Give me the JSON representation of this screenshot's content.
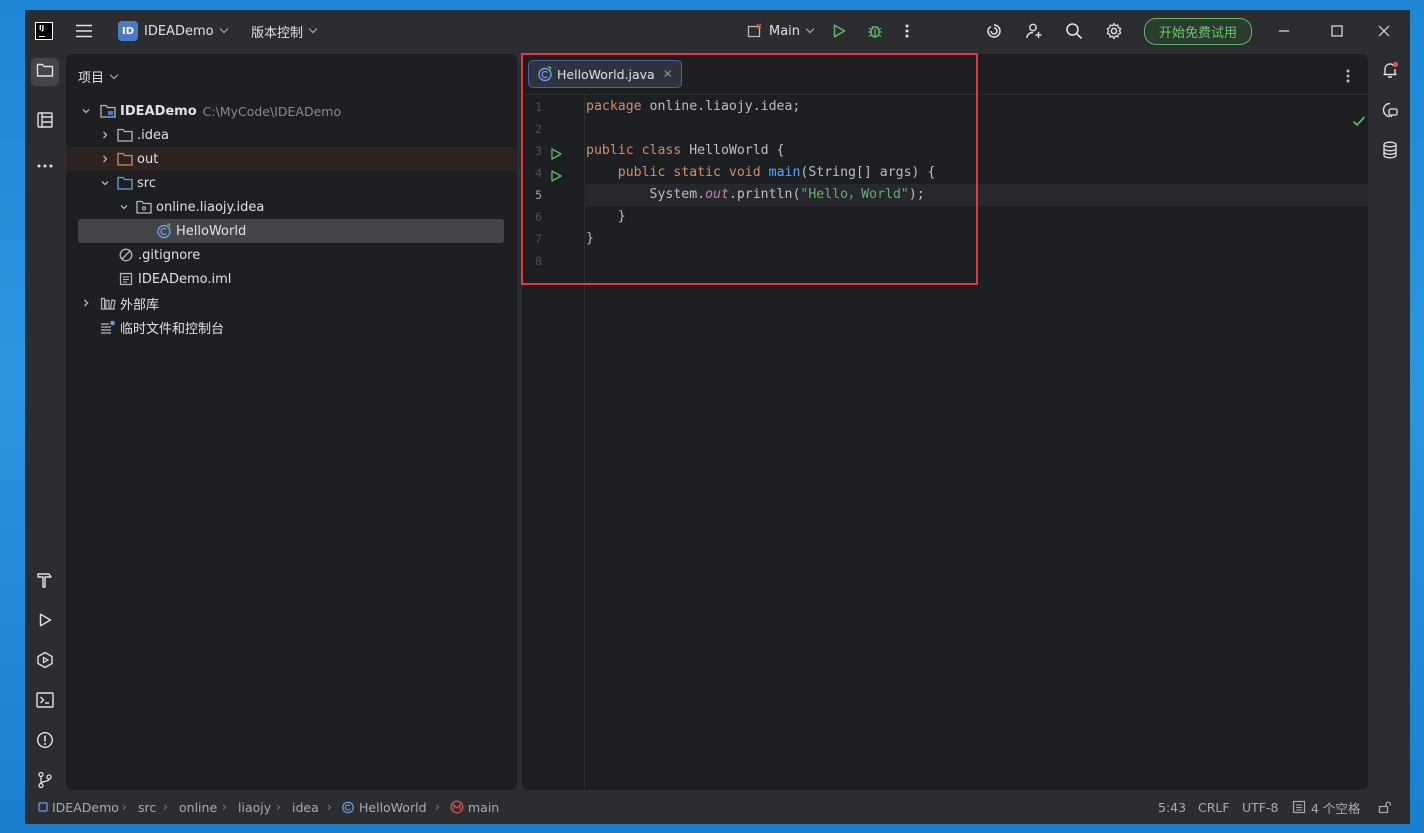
{
  "titlebar": {
    "project_name": "IDEADemo",
    "project_badge": "ID",
    "vcs_label": "版本控制",
    "run_config": "Main",
    "trial_button": "开始免费试用"
  },
  "project_panel": {
    "header": "项目",
    "tree": [
      {
        "label": "IDEADemo",
        "hint": "C:\\MyCode\\IDEADemo"
      },
      {
        "label": ".idea"
      },
      {
        "label": "out"
      },
      {
        "label": "src"
      },
      {
        "label": "online.liaojy.idea"
      },
      {
        "label": "HelloWorld"
      },
      {
        "label": ".gitignore"
      },
      {
        "label": "IDEADemo.iml"
      },
      {
        "label": "外部库"
      },
      {
        "label": "临时文件和控制台"
      }
    ]
  },
  "editor": {
    "tab_label": "HelloWorld.java",
    "line_numbers": [
      "1",
      "2",
      "3",
      "4",
      "5",
      "6",
      "7",
      "8"
    ],
    "current_line": 5,
    "code": {
      "l1_kw": "package",
      "l1_rest": " online.liaojy.idea;",
      "l3_kw": "public class",
      "l3_rest": " HelloWorld {",
      "l4_indent": "    ",
      "l4_kw": "public static void",
      "l4_sp": " ",
      "l4_fn": "main",
      "l4_rest": "(String[] args) {",
      "l5_indent": "        System.",
      "l5_static": "out",
      "l5_mid": ".println(",
      "l5_str": "\"Hello，World\"",
      "l5_end": ");",
      "l6": "    }",
      "l7": "}"
    }
  },
  "statusbar": {
    "breadcrumbs": [
      "IDEADemo",
      "src",
      "online",
      "liaojy",
      "idea",
      "HelloWorld",
      "main"
    ],
    "position": "5:43",
    "line_ending": "CRLF",
    "encoding": "UTF-8",
    "indent": "4 个空格"
  },
  "colors": {
    "accent": "#4d79c7",
    "highlight_box": "#e0393e",
    "run_green": "#5fb865"
  }
}
